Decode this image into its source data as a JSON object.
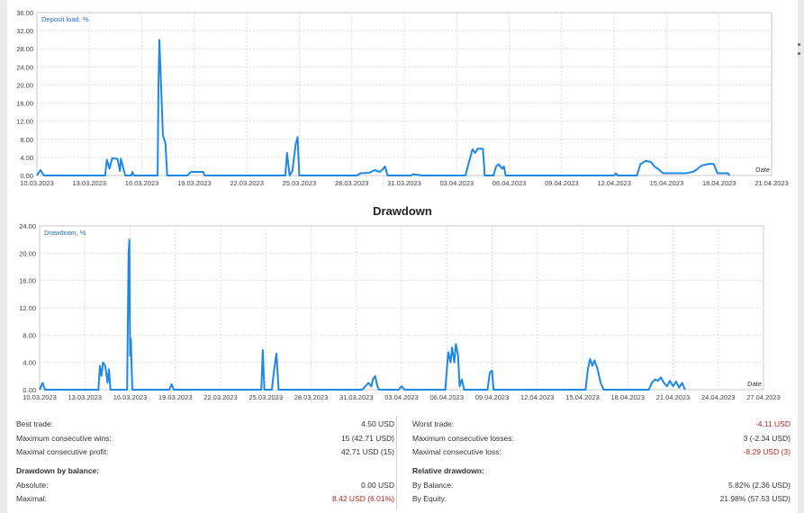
{
  "chart_data": [
    {
      "type": "line",
      "title": "Deposit load, %",
      "xlabel": "Date",
      "ylim": [
        0,
        36
      ],
      "yticks": [
        "0.00",
        "4.00",
        "8.00",
        "12.00",
        "16.00",
        "20.00",
        "24.00",
        "28.00",
        "32.00",
        "36.00"
      ],
      "xticks": [
        "10.03.2023",
        "13.03.2023",
        "16.03.2023",
        "19.03.2023",
        "22.03.2023",
        "25.03.2023",
        "28.03.2023",
        "31.03.2023",
        "03.04.2023",
        "06.04.2023",
        "09.04.2023",
        "12.04.2023",
        "15.04.2023",
        "18.04.2023",
        "21.04.2023"
      ],
      "x_unit": "days since 10.03.2023",
      "xlim": [
        0,
        42
      ],
      "color": "#1e88e5",
      "grid": true,
      "points": [
        [
          0,
          0
        ],
        [
          0.2,
          1.2
        ],
        [
          0.4,
          0
        ],
        [
          3.9,
          0
        ],
        [
          4,
          3.5
        ],
        [
          4.15,
          1.5
        ],
        [
          4.3,
          3.8
        ],
        [
          4.6,
          3.7
        ],
        [
          4.75,
          1
        ],
        [
          4.8,
          3.7
        ],
        [
          5.05,
          0
        ],
        [
          5.4,
          0
        ],
        [
          5.45,
          0.8
        ],
        [
          5.55,
          0
        ],
        [
          6.9,
          0
        ],
        [
          6.95,
          20
        ],
        [
          7,
          30
        ],
        [
          7.1,
          20
        ],
        [
          7.2,
          9
        ],
        [
          7.35,
          7
        ],
        [
          7.45,
          0
        ],
        [
          8.6,
          0
        ],
        [
          8.8,
          0.8
        ],
        [
          9.5,
          0.8
        ],
        [
          9.6,
          0
        ],
        [
          13.9,
          0
        ],
        [
          14.2,
          0
        ],
        [
          14.3,
          5
        ],
        [
          14.45,
          0
        ],
        [
          14.6,
          1
        ],
        [
          14.8,
          7
        ],
        [
          14.9,
          8.5
        ],
        [
          15,
          0
        ],
        [
          18.3,
          0
        ],
        [
          18.5,
          0.5
        ],
        [
          19,
          0.6
        ],
        [
          19.3,
          1.2
        ],
        [
          19.6,
          0.8
        ],
        [
          19.8,
          1.5
        ],
        [
          19.9,
          2
        ],
        [
          20.05,
          0
        ],
        [
          21.4,
          0
        ],
        [
          21.5,
          0.3
        ],
        [
          22,
          0
        ],
        [
          24.5,
          0
        ],
        [
          24.7,
          3
        ],
        [
          24.9,
          5.8
        ],
        [
          25.05,
          5
        ],
        [
          25.2,
          5.9
        ],
        [
          25.5,
          5.9
        ],
        [
          25.6,
          0
        ],
        [
          26.1,
          0
        ],
        [
          26.25,
          2
        ],
        [
          26.4,
          2.5
        ],
        [
          26.6,
          1.5
        ],
        [
          26.7,
          2
        ],
        [
          26.8,
          0
        ],
        [
          33,
          0
        ],
        [
          33.1,
          0.5
        ],
        [
          33.2,
          0
        ],
        [
          34.3,
          0
        ],
        [
          34.5,
          2.5
        ],
        [
          34.8,
          3.2
        ],
        [
          35.1,
          3
        ],
        [
          35.3,
          2
        ],
        [
          35.5,
          1.5
        ],
        [
          35.8,
          0.5
        ],
        [
          37.1,
          0.5
        ],
        [
          37.5,
          0.8
        ],
        [
          37.7,
          1.3
        ],
        [
          38,
          2.2
        ],
        [
          38.5,
          2.6
        ],
        [
          38.7,
          2.5
        ],
        [
          38.9,
          0.5
        ],
        [
          39.5,
          0.5
        ],
        [
          39.6,
          0
        ]
      ]
    },
    {
      "type": "line",
      "title": "Drawdown, %",
      "xlabel": "Date",
      "ylim": [
        0,
        24
      ],
      "yticks": [
        "0.00",
        "4.00",
        "8.00",
        "12.00",
        "16.00",
        "20.00",
        "24.00"
      ],
      "xticks": [
        "10.03.2023",
        "13.03.2023",
        "16.03.2023",
        "19.03.2023",
        "22.03.2023",
        "25.03.2023",
        "28.03.2023",
        "31.03.2023",
        "03.04.2023",
        "06.04.2023",
        "09.04.2023",
        "12.04.2023",
        "15.04.2023",
        "18.04.2023",
        "21.04.2023",
        "24.04.2023",
        "27.04.2023"
      ],
      "x_unit": "days since 10.03.2023",
      "xlim": [
        0,
        48
      ],
      "color": "#1e88e5",
      "grid": true,
      "points": [
        [
          0,
          0
        ],
        [
          0.2,
          1
        ],
        [
          0.35,
          0
        ],
        [
          3.9,
          0
        ],
        [
          4,
          3.5
        ],
        [
          4.1,
          2
        ],
        [
          4.2,
          4
        ],
        [
          4.35,
          3.5
        ],
        [
          4.5,
          1
        ],
        [
          4.6,
          3
        ],
        [
          4.7,
          0
        ],
        [
          5.8,
          0
        ],
        [
          5.9,
          20
        ],
        [
          5.95,
          22
        ],
        [
          6,
          5
        ],
        [
          6.05,
          7.5
        ],
        [
          6.15,
          0
        ],
        [
          8.6,
          0
        ],
        [
          8.75,
          0.8
        ],
        [
          8.9,
          0
        ],
        [
          14.7,
          0
        ],
        [
          14.8,
          5.8
        ],
        [
          14.9,
          0
        ],
        [
          15.4,
          0
        ],
        [
          15.55,
          3
        ],
        [
          15.7,
          5.3
        ],
        [
          15.85,
          0
        ],
        [
          21.4,
          0
        ],
        [
          21.6,
          0.5
        ],
        [
          21.8,
          1
        ],
        [
          22,
          0.5
        ],
        [
          22.1,
          1.5
        ],
        [
          22.25,
          2
        ],
        [
          22.4,
          0.5
        ],
        [
          22.5,
          0
        ],
        [
          23.8,
          0
        ],
        [
          24,
          0.5
        ],
        [
          24.2,
          0
        ],
        [
          26.9,
          0
        ],
        [
          27,
          3
        ],
        [
          27.1,
          5.5
        ],
        [
          27.25,
          4
        ],
        [
          27.35,
          6.2
        ],
        [
          27.5,
          4
        ],
        [
          27.6,
          6.7
        ],
        [
          27.75,
          5
        ],
        [
          27.85,
          0.5
        ],
        [
          28,
          1.5
        ],
        [
          28.15,
          0
        ],
        [
          29.7,
          0
        ],
        [
          29.85,
          2.5
        ],
        [
          30,
          2.8
        ],
        [
          30.1,
          0
        ],
        [
          36.2,
          0
        ],
        [
          36.35,
          3
        ],
        [
          36.5,
          4.5
        ],
        [
          36.65,
          3.5
        ],
        [
          36.8,
          4.3
        ],
        [
          37,
          3
        ],
        [
          37.2,
          1
        ],
        [
          37.4,
          0
        ],
        [
          40.4,
          0
        ],
        [
          40.6,
          1
        ],
        [
          40.8,
          1.5
        ],
        [
          41,
          1.3
        ],
        [
          41.2,
          1.8
        ],
        [
          41.4,
          1
        ],
        [
          41.6,
          0.5
        ],
        [
          41.8,
          1.3
        ],
        [
          42,
          0.5
        ],
        [
          42.2,
          1.2
        ],
        [
          42.4,
          0.3
        ],
        [
          42.6,
          1
        ],
        [
          42.8,
          0
        ]
      ]
    }
  ],
  "drawdown_heading": "Drawdown",
  "stats": {
    "left": [
      {
        "label": "Best trade:",
        "value": "4.50 USD",
        "red": false
      },
      {
        "label": "Maximum consecutive wins:",
        "value": "15 (42.71 USD)",
        "red": false
      },
      {
        "label": "Maximal consecutive profit:",
        "value": "42.71 USD (15)",
        "red": false
      }
    ],
    "right": [
      {
        "label": "Worst trade:",
        "value": "-4.11 USD",
        "red": true
      },
      {
        "label": "Maximum consecutive losses:",
        "value": "3 (-2.34 USD)",
        "red": false
      },
      {
        "label": "Maximal consecutive loss:",
        "value": "-8.29 USD (3)",
        "red": true
      }
    ],
    "left_heading": "Drawdown by balance:",
    "right_heading": "Relative drawdown:",
    "left2": [
      {
        "label": "Absolute:",
        "value": "0.00 USD",
        "red": false
      },
      {
        "label": "Maximal:",
        "value": "8.42 USD (6.01%)",
        "red": true
      }
    ],
    "right2": [
      {
        "label": "By Balance:",
        "value": "5.82% (2.36 USD)",
        "red": false
      },
      {
        "label": "By Equity:",
        "value": "21.98% (57.53 USD)",
        "red": false
      }
    ]
  }
}
